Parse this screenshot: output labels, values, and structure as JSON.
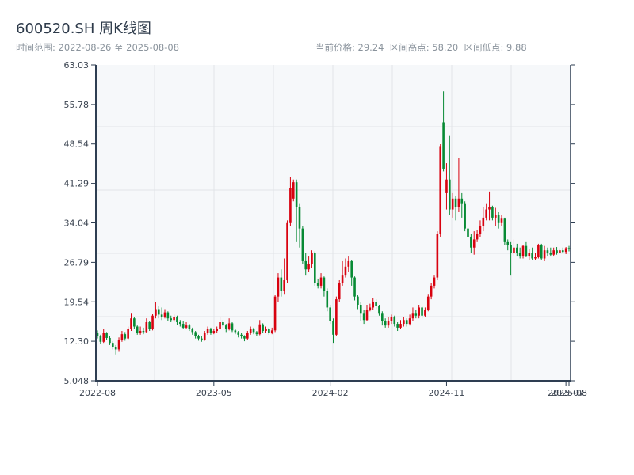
{
  "header": {
    "title": "600520.SH 周K线图",
    "range_text": "时间范围: 2022-08-26 至 2025-08-08",
    "stats_text": "当前价格: 29.24  区间高点: 58.20  区间低点: 9.88"
  },
  "colors": {
    "up": "#d8020f",
    "down": "#078a34",
    "axis": "#2e3e52",
    "grid": "#e1e4e8",
    "plot_bg": "#f6f8fa"
  },
  "chart_data": {
    "type": "candlestick",
    "title": "600520.SH 周K线图",
    "ylim": [
      5.048,
      63.03
    ],
    "yticks": [
      "63.03",
      "55.78",
      "48.54",
      "41.29",
      "34.04",
      "26.79",
      "19.54",
      "12.30",
      "5.048"
    ],
    "xticks": [
      {
        "label": "2022-08",
        "index": 0
      },
      {
        "label": "2023-05",
        "index": 38
      },
      {
        "label": "2024-02",
        "index": 76
      },
      {
        "label": "2024-11",
        "index": 114
      },
      {
        "label": "2025-07",
        "index": 153
      },
      {
        "label": "2025-08",
        "index": 154
      }
    ],
    "ohlc_fields": [
      "open",
      "high",
      "low",
      "close"
    ],
    "ohlc": [
      [
        13.8,
        14.3,
        12.8,
        13.2
      ],
      [
        13.2,
        13.5,
        11.8,
        12.2
      ],
      [
        12.2,
        14.6,
        12.0,
        13.8
      ],
      [
        13.8,
        14.0,
        12.5,
        12.9
      ],
      [
        12.9,
        13.2,
        11.6,
        12.0
      ],
      [
        12.0,
        12.3,
        10.8,
        11.3
      ],
      [
        11.3,
        11.6,
        9.88,
        10.8
      ],
      [
        10.8,
        13.0,
        10.5,
        12.6
      ],
      [
        12.6,
        14.2,
        12.2,
        13.6
      ],
      [
        13.6,
        14.0,
        12.4,
        12.8
      ],
      [
        12.8,
        15.0,
        12.6,
        14.5
      ],
      [
        14.5,
        17.5,
        14.2,
        16.5
      ],
      [
        16.5,
        16.8,
        14.5,
        15.0
      ],
      [
        15.0,
        15.2,
        13.5,
        13.8
      ],
      [
        13.8,
        15.0,
        13.5,
        14.2
      ],
      [
        14.2,
        14.8,
        13.6,
        14.0
      ],
      [
        14.0,
        16.5,
        13.8,
        15.8
      ],
      [
        15.8,
        16.0,
        14.2,
        14.5
      ],
      [
        14.5,
        17.4,
        14.3,
        17.0
      ],
      [
        17.0,
        19.5,
        16.5,
        18.2
      ],
      [
        18.2,
        18.8,
        16.5,
        17.2
      ],
      [
        17.2,
        18.5,
        16.2,
        16.8
      ],
      [
        16.8,
        18.2,
        16.5,
        17.6
      ],
      [
        17.6,
        17.8,
        16.0,
        16.5
      ],
      [
        16.5,
        17.0,
        15.8,
        16.2
      ],
      [
        16.2,
        17.2,
        15.8,
        16.8
      ],
      [
        16.8,
        17.0,
        15.3,
        15.8
      ],
      [
        15.8,
        16.2,
        15.0,
        15.5
      ],
      [
        15.5,
        16.0,
        14.5,
        14.8
      ],
      [
        14.8,
        15.8,
        14.5,
        15.2
      ],
      [
        15.2,
        15.5,
        14.2,
        14.6
      ],
      [
        14.6,
        14.8,
        13.5,
        14.0
      ],
      [
        14.0,
        14.2,
        12.8,
        13.2
      ],
      [
        13.2,
        13.5,
        12.4,
        12.8
      ],
      [
        12.8,
        13.2,
        12.2,
        12.6
      ],
      [
        12.6,
        14.2,
        12.4,
        13.8
      ],
      [
        13.8,
        15.0,
        13.5,
        14.5
      ],
      [
        14.5,
        14.8,
        13.5,
        13.9
      ],
      [
        13.9,
        14.6,
        13.6,
        14.2
      ],
      [
        14.2,
        15.0,
        13.9,
        14.6
      ],
      [
        14.6,
        16.8,
        14.4,
        15.8
      ],
      [
        15.8,
        16.2,
        14.8,
        15.2
      ],
      [
        15.2,
        15.5,
        14.0,
        14.5
      ],
      [
        14.5,
        16.5,
        14.3,
        15.6
      ],
      [
        15.6,
        15.8,
        14.0,
        14.3
      ],
      [
        14.3,
        14.6,
        13.6,
        14.0
      ],
      [
        14.0,
        14.2,
        13.0,
        13.5
      ],
      [
        13.5,
        13.8,
        12.8,
        13.2
      ],
      [
        13.2,
        13.4,
        12.3,
        12.8
      ],
      [
        12.8,
        14.2,
        12.6,
        13.8
      ],
      [
        13.8,
        15.0,
        13.5,
        14.6
      ],
      [
        14.6,
        14.8,
        13.6,
        14.0
      ],
      [
        14.0,
        14.2,
        13.2,
        13.6
      ],
      [
        13.6,
        16.2,
        13.4,
        15.4
      ],
      [
        15.4,
        15.6,
        13.8,
        14.2
      ],
      [
        14.2,
        15.0,
        13.8,
        14.6
      ],
      [
        14.6,
        14.8,
        13.5,
        13.8
      ],
      [
        13.8,
        14.8,
        13.6,
        14.3
      ],
      [
        14.3,
        20.8,
        14.0,
        20.5
      ],
      [
        20.5,
        24.8,
        19.5,
        24.0
      ],
      [
        24.0,
        25.5,
        20.5,
        21.5
      ],
      [
        21.5,
        27.5,
        21.0,
        23.5
      ],
      [
        23.5,
        34.5,
        23.0,
        34.0
      ],
      [
        34.0,
        42.5,
        33.5,
        40.5
      ],
      [
        38.5,
        42.0,
        38.0,
        41.5
      ],
      [
        41.5,
        42.0,
        30.5,
        37.0
      ],
      [
        37.0,
        37.5,
        29.5,
        33.0
      ],
      [
        33.0,
        33.5,
        26.5,
        27.0
      ],
      [
        27.0,
        28.5,
        24.5,
        25.5
      ],
      [
        25.5,
        28.0,
        25.0,
        26.5
      ],
      [
        26.5,
        29.0,
        25.8,
        28.5
      ],
      [
        28.5,
        28.8,
        22.5,
        23.0
      ],
      [
        23.0,
        23.8,
        22.0,
        22.5
      ],
      [
        22.5,
        24.8,
        22.0,
        24.0
      ],
      [
        24.0,
        24.2,
        20.5,
        21.5
      ],
      [
        21.5,
        22.0,
        17.8,
        18.5
      ],
      [
        18.5,
        19.0,
        15.5,
        16.0
      ],
      [
        16.0,
        16.5,
        12.0,
        13.5
      ],
      [
        13.5,
        20.5,
        13.2,
        20.0
      ],
      [
        20.0,
        23.5,
        19.5,
        23.0
      ],
      [
        23.0,
        27.0,
        22.5,
        24.5
      ],
      [
        24.5,
        27.5,
        24.0,
        26.0
      ],
      [
        26.0,
        28.0,
        25.0,
        27.0
      ],
      [
        27.0,
        27.2,
        22.5,
        24.0
      ],
      [
        24.0,
        24.2,
        19.8,
        20.5
      ],
      [
        20.5,
        20.8,
        18.2,
        19.0
      ],
      [
        19.0,
        19.5,
        16.0,
        17.5
      ],
      [
        17.5,
        18.0,
        15.5,
        16.2
      ],
      [
        16.2,
        19.0,
        16.0,
        18.0
      ],
      [
        18.0,
        19.2,
        17.8,
        18.5
      ],
      [
        18.5,
        20.2,
        18.0,
        19.5
      ],
      [
        19.5,
        20.0,
        18.2,
        18.8
      ],
      [
        18.8,
        19.0,
        17.0,
        17.5
      ],
      [
        17.5,
        17.8,
        15.2,
        16.0
      ],
      [
        16.0,
        16.5,
        14.8,
        15.2
      ],
      [
        15.2,
        16.8,
        14.8,
        16.0
      ],
      [
        16.0,
        17.2,
        15.5,
        16.8
      ],
      [
        16.8,
        17.0,
        15.0,
        15.5
      ],
      [
        15.5,
        15.8,
        14.2,
        14.8
      ],
      [
        14.8,
        16.2,
        14.5,
        15.5
      ],
      [
        15.5,
        16.8,
        15.0,
        16.2
      ],
      [
        16.2,
        16.5,
        15.0,
        15.5
      ],
      [
        15.5,
        17.2,
        15.2,
        16.5
      ],
      [
        16.5,
        18.5,
        16.0,
        17.5
      ],
      [
        17.5,
        18.0,
        16.5,
        17.0
      ],
      [
        17.0,
        19.0,
        16.5,
        18.5
      ],
      [
        18.5,
        18.8,
        16.5,
        17.0
      ],
      [
        17.0,
        18.5,
        16.8,
        18.0
      ],
      [
        18.0,
        21.0,
        17.8,
        20.5
      ],
      [
        20.5,
        23.0,
        20.0,
        22.5
      ],
      [
        22.5,
        24.5,
        22.0,
        24.0
      ],
      [
        24.0,
        32.5,
        23.5,
        32.0
      ],
      [
        32.0,
        48.5,
        31.5,
        48.0
      ],
      [
        52.5,
        58.2,
        43.5,
        44.0
      ],
      [
        39.5,
        45.0,
        36.5,
        42.0
      ],
      [
        42.0,
        50.0,
        35.5,
        36.5
      ],
      [
        36.5,
        39.5,
        35.0,
        38.5
      ],
      [
        38.5,
        39.0,
        34.5,
        37.0
      ],
      [
        37.0,
        46.0,
        36.0,
        38.5
      ],
      [
        38.5,
        39.5,
        35.0,
        37.5
      ],
      [
        37.5,
        38.0,
        32.5,
        33.0
      ],
      [
        33.0,
        34.0,
        30.5,
        31.5
      ],
      [
        31.5,
        32.0,
        28.5,
        29.5
      ],
      [
        29.5,
        32.5,
        28.2,
        31.0
      ],
      [
        31.0,
        32.8,
        30.5,
        32.0
      ],
      [
        32.0,
        34.5,
        31.5,
        33.5
      ],
      [
        33.5,
        37.0,
        32.5,
        35.0
      ],
      [
        35.0,
        37.5,
        34.5,
        36.5
      ],
      [
        36.5,
        39.8,
        34.5,
        37.0
      ],
      [
        37.0,
        37.2,
        34.5,
        35.0
      ],
      [
        35.0,
        36.8,
        33.5,
        35.5
      ],
      [
        35.5,
        36.0,
        33.0,
        34.0
      ],
      [
        34.0,
        35.5,
        33.5,
        34.8
      ],
      [
        34.8,
        35.0,
        30.0,
        30.5
      ],
      [
        30.5,
        31.0,
        29.0,
        30.0
      ],
      [
        30.0,
        30.5,
        24.5,
        28.5
      ],
      [
        28.5,
        31.0,
        28.0,
        29.5
      ],
      [
        29.5,
        30.2,
        28.0,
        28.5
      ],
      [
        28.5,
        29.5,
        27.5,
        28.0
      ],
      [
        28.0,
        30.0,
        27.5,
        29.8
      ],
      [
        29.8,
        30.5,
        27.8,
        28.0
      ],
      [
        28.0,
        29.2,
        27.2,
        28.5
      ],
      [
        28.5,
        29.5,
        27.2,
        27.5
      ],
      [
        27.5,
        28.5,
        27.2,
        27.8
      ],
      [
        27.8,
        30.2,
        27.5,
        30.0
      ],
      [
        30.0,
        30.2,
        27.2,
        27.5
      ],
      [
        27.5,
        29.8,
        27.0,
        29.0
      ],
      [
        29.0,
        29.5,
        28.0,
        28.5
      ],
      [
        28.5,
        29.5,
        28.0,
        28.2
      ],
      [
        28.2,
        29.5,
        28.0,
        29.0
      ],
      [
        29.0,
        29.6,
        28.2,
        28.5
      ],
      [
        28.5,
        29.4,
        28.5,
        29.0
      ],
      [
        29.0,
        29.5,
        28.5,
        28.7
      ],
      [
        28.7,
        29.6,
        28.3,
        29.4
      ],
      [
        29.4,
        29.8,
        28.8,
        29.24
      ]
    ]
  }
}
